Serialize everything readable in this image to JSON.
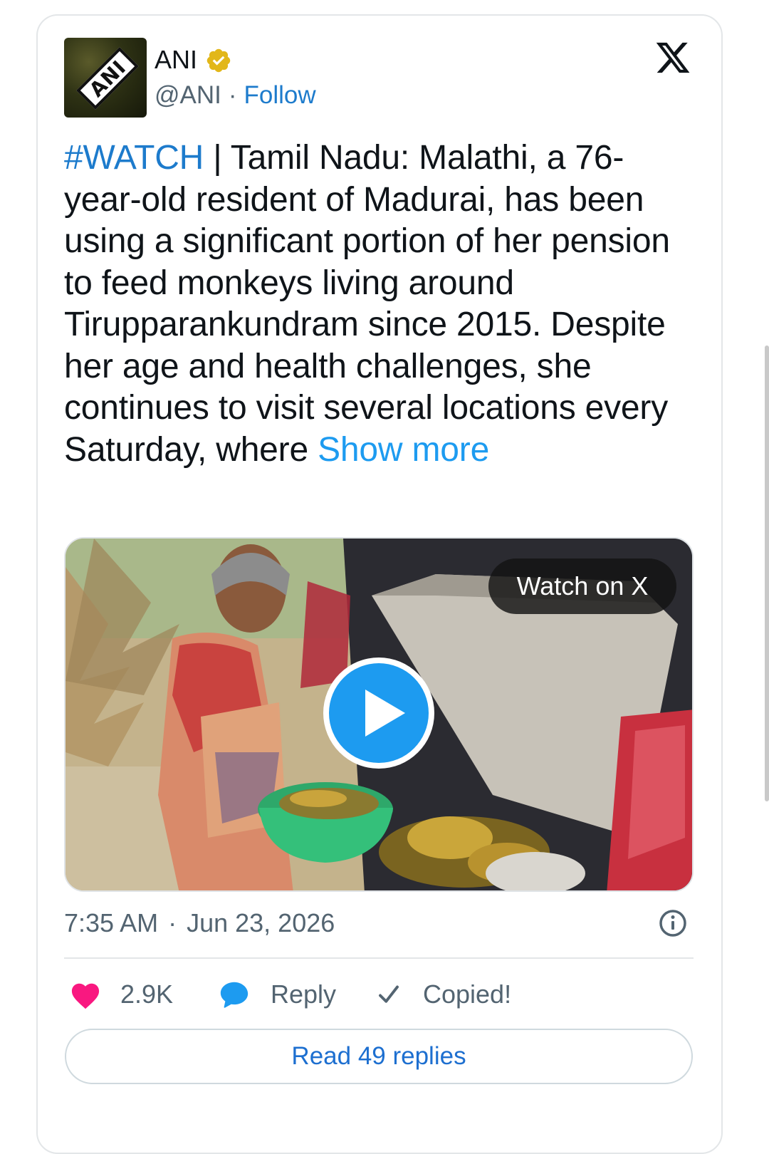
{
  "author": {
    "name": "ANI",
    "handle": "@ANI",
    "separator": "·",
    "follow_label": "Follow",
    "avatar_text": "ANI",
    "verified": true
  },
  "platform_logo": "x-logo-icon",
  "tweet": {
    "hashtag": "#WATCH",
    "body": " | Tamil Nadu: Malathi, a 76-year-old resident of Madurai, has been using a significant portion of her pension to feed monkeys living around Tirupparankundram since 2015. Despite her age and health challenges, she continues to visit several locations every Saturday, where ",
    "show_more_label": "Show more"
  },
  "media": {
    "watch_label": "Watch on X",
    "play_icon": "play-icon"
  },
  "meta": {
    "time": "7:35 AM",
    "separator": "·",
    "date": "Jun 23, 2026",
    "info_icon": "info-icon"
  },
  "actions": {
    "like_count": "2.9K",
    "reply_label": "Reply",
    "copy_label": "Copied!"
  },
  "read_replies_label": "Read 49 replies",
  "colors": {
    "link_blue": "#1d9bf0",
    "hashtag_blue": "#1d7bcc",
    "like_pink": "#f91880",
    "reply_blue": "#1d9bf0",
    "verified_gold": "#e2b719",
    "text_primary": "#0f1419",
    "text_secondary": "#536471"
  }
}
